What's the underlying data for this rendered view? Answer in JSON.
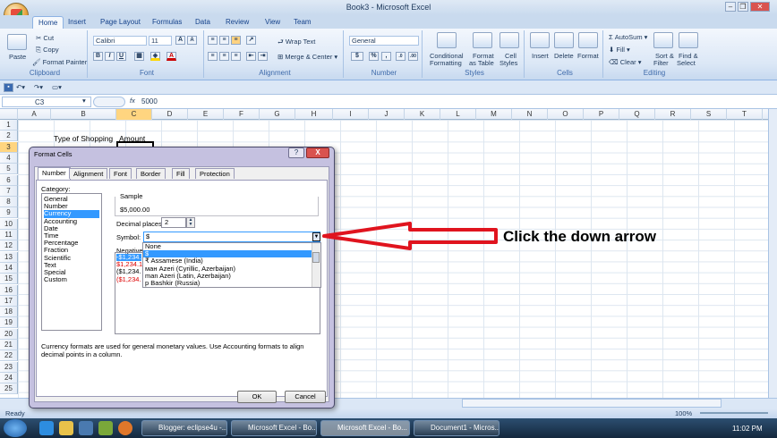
{
  "window": {
    "title": "Book3 - Microsoft Excel"
  },
  "ribbon": {
    "tabs": [
      "Home",
      "Insert",
      "Page Layout",
      "Formulas",
      "Data",
      "Review",
      "View",
      "Team"
    ],
    "clipboard": {
      "paste": "Paste",
      "cut": "Cut",
      "copy": "Copy",
      "format_painter": "Format Painter",
      "label": "Clipboard"
    },
    "font": {
      "name": "Calibri",
      "size": "11",
      "label": "Font",
      "bold": "B",
      "italic": "I",
      "underline": "U",
      "grow": "A",
      "shrink": "A"
    },
    "alignment": {
      "wrap_text": "Wrap Text",
      "merge_center": "Merge & Center",
      "label": "Alignment"
    },
    "number": {
      "format": "General",
      "currency": "$",
      "percent": "%",
      "comma": ",",
      "label": "Number"
    },
    "styles": {
      "conditional": "Conditional",
      "conditional2": "Formatting",
      "format_as": "Format",
      "format_as2": "as Table",
      "cell": "Cell",
      "cell2": "Styles",
      "label": "Styles"
    },
    "cells": {
      "insert": "Insert",
      "delete": "Delete",
      "format": "Format",
      "label": "Cells"
    },
    "editing": {
      "autosum": "AutoSum",
      "fill": "Fill",
      "clear": "Clear",
      "sort": "Sort &",
      "sort2": "Filter",
      "find": "Find &",
      "find2": "Select",
      "label": "Editing"
    }
  },
  "formula_bar": {
    "name_box": "C3",
    "fx": "fx",
    "value": "5000"
  },
  "columns": [
    "A",
    "B",
    "C",
    "D",
    "E",
    "F",
    "G",
    "H",
    "I",
    "J",
    "K",
    "L",
    "M",
    "N",
    "O",
    "P",
    "Q",
    "R",
    "S",
    "T"
  ],
  "rows": [
    "1",
    "2",
    "3",
    "4",
    "5",
    "6",
    "7",
    "8",
    "9",
    "10",
    "11",
    "12",
    "13",
    "14",
    "15",
    "16",
    "17",
    "18",
    "19",
    "20",
    "21",
    "22",
    "23",
    "24",
    "25"
  ],
  "cells": {
    "b2": "Type of Shopping",
    "c2": "Amount"
  },
  "dialog": {
    "title": "Format Cells",
    "tabs": [
      "Number",
      "Alignment",
      "Font",
      "Border",
      "Fill",
      "Protection"
    ],
    "category_label": "Category:",
    "categories": [
      "General",
      "Number",
      "Currency",
      "Accounting",
      "Date",
      "Time",
      "Percentage",
      "Fraction",
      "Scientific",
      "Text",
      "Special",
      "Custom"
    ],
    "selected_category": "Currency",
    "sample_label": "Sample",
    "sample_value": "$5,000.00",
    "decimal_label": "Decimal places:",
    "decimal_value": "2",
    "symbol_label": "Symbol:",
    "symbol_value": "$",
    "negative_label": "Negative",
    "negatives": [
      "-$1,234.",
      "$1,234.1",
      "($1,234.",
      "($1,234."
    ],
    "symbol_options": [
      "None",
      "$",
      "Assamese (India)",
      "Azeri (Cyrillic, Azerbaijan)",
      "Azeri (Latin, Azerbaijan)",
      "Bashkir (Russia)"
    ],
    "description": "Currency formats are used for general monetary values.  Use Accounting formats to align decimal points in a column.",
    "ok": "OK",
    "cancel": "Cancel",
    "help": "?",
    "close": "X"
  },
  "annotation": {
    "text": "Click the down arrow",
    "color": "#e0141e"
  },
  "status": {
    "ready": "Ready",
    "zoom": "100%"
  },
  "taskbar": {
    "items": [
      "Blogger: eclipse4u -...",
      "Microsoft Excel - Bo...",
      "Microsoft Excel - Bo...",
      "Document1 - Micros..."
    ],
    "time": "11:02 PM"
  }
}
